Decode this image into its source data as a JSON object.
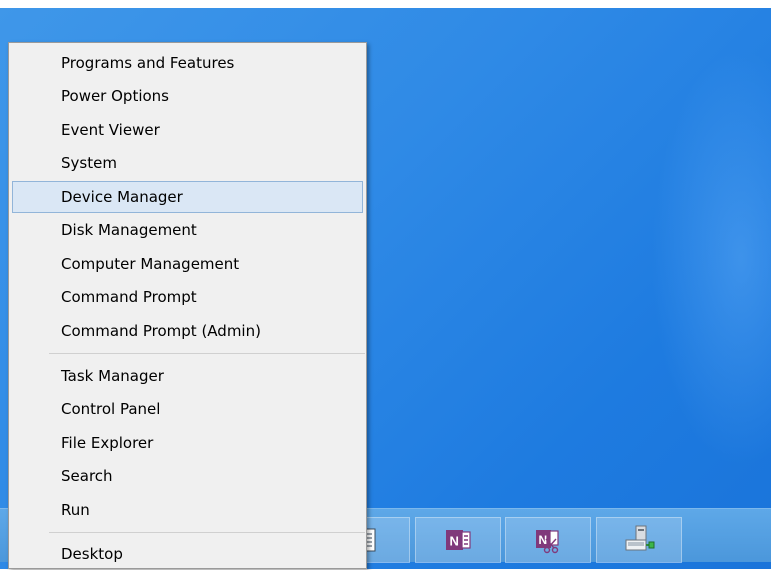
{
  "menu": {
    "items": [
      {
        "label": "Programs and Features",
        "selected": false
      },
      {
        "label": "Power Options",
        "selected": false
      },
      {
        "label": "Event Viewer",
        "selected": false
      },
      {
        "label": "System",
        "selected": false
      },
      {
        "label": "Device Manager",
        "selected": true
      },
      {
        "label": "Disk Management",
        "selected": false
      },
      {
        "label": "Computer Management",
        "selected": false
      },
      {
        "label": "Command Prompt",
        "selected": false
      },
      {
        "label": "Command Prompt (Admin)",
        "selected": false
      },
      {
        "label": "Task Manager",
        "selected": false
      },
      {
        "label": "Control Panel",
        "selected": false
      },
      {
        "label": "File Explorer",
        "selected": false
      },
      {
        "label": "Search",
        "selected": false
      },
      {
        "label": "Run",
        "selected": false
      },
      {
        "label": "Desktop",
        "selected": false
      }
    ],
    "highlight_color": "#dae7f5"
  },
  "taskbar": {
    "apps": [
      {
        "icon": "notepad-icon"
      },
      {
        "icon": "onenote-icon"
      },
      {
        "icon": "onenote-clipping-icon"
      },
      {
        "icon": "network-computer-icon"
      }
    ]
  },
  "desktop": {
    "background_color": "#2f8ae6"
  }
}
